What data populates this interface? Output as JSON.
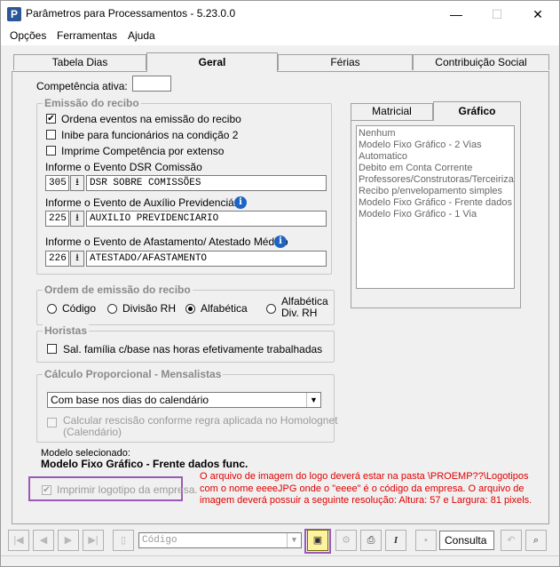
{
  "window": {
    "title": "Parâmetros para Processamentos - 5.23.0.0",
    "icon_letter": "P",
    "controls": {
      "minimize": "—",
      "maximize": "☐",
      "close": "✕"
    }
  },
  "menu": {
    "items": [
      "Opções",
      "Ferramentas",
      "Ajuda"
    ]
  },
  "tabs": [
    "Tabela Dias",
    "Geral",
    "Férias",
    "Contribuição Social"
  ],
  "active_tab": "Geral",
  "competencia": {
    "label": "Competência ativa:",
    "value": ""
  },
  "emissao": {
    "title": "Emissão do recibo",
    "checks": [
      {
        "label": "Ordena eventos na emissão do recibo",
        "checked": true
      },
      {
        "label": "Inibe para funcionários na condição 2",
        "checked": false
      },
      {
        "label": "Imprime Competência por extenso",
        "checked": false
      }
    ],
    "events": [
      {
        "label": "Informe o Evento DSR Comissão",
        "code": "305",
        "desc": "DSR SOBRE COMISSÕES",
        "info": false
      },
      {
        "label": "Informe o Evento de Auxílio Previdenciário",
        "code": "225",
        "desc": "AUXILIO PREVIDENCIARIO",
        "info": true
      },
      {
        "label": "Informe o Evento de Afastamento/ Atestado Médico",
        "code": "226",
        "desc": "ATESTADO/AFASTAMENTO",
        "info": true
      }
    ],
    "dl_glyph": "⭳",
    "info_glyph": "i"
  },
  "ordem": {
    "title": "Ordem de emissão do recibo",
    "options": [
      "Código",
      "Divisão RH",
      "Alfabética",
      "Alfabética",
      "Div. RH"
    ],
    "selected": "Alfabética"
  },
  "horistas": {
    "title": "Horistas",
    "check": {
      "label": "Sal. família c/base nas horas efetivamente trabalhadas",
      "checked": false
    }
  },
  "calculo": {
    "title": "Cálculo Proporcional - Mensalistas",
    "select_value": "Com base nos dias do calendário",
    "check_line1": "Calcular rescisão conforme regra aplicada no Homolognet",
    "check_line2": "(Calendário)"
  },
  "modelo": {
    "label": "Modelo selecionado:",
    "value": "Modelo Fixo Gráfico - Frente dados func."
  },
  "logotipo": {
    "label": "Imprimir logotipo da empresa.",
    "checked": true
  },
  "note": [
    "O arquivo de imagem do logo deverá estar na pasta \\PROEMP??\\Logotipos",
    "com o nome eeeeJPG onde o \"eeee\" é o código da empresa. O arquivo de",
    "imagem deverá possuir a seguinte resolução: Altura: 57 e Largura: 81 pixels."
  ],
  "subtabs": [
    "Matricial",
    "Gráfico"
  ],
  "active_subtab": "Gráfico",
  "models_list": [
    "Nenhum",
    "Modelo Fixo Gráfico - 2 Vias",
    "Automatico",
    "Debito em Conta Corrente",
    "Professores/Construtoras/Terceiriza",
    "Recibo p/envelopamento simples",
    "Modelo Fixo Gráfico - Frente dados",
    "Modelo Fixo Gráfico - 1 Via"
  ],
  "toolbar": {
    "nav": [
      "|◀",
      "◀",
      "▶",
      "▶|"
    ],
    "search_placeholder": "Código",
    "consulta": "Consulta"
  },
  "colors": {
    "note_red": "#e00000",
    "highlight": "#9b59b6",
    "info_blue": "#1e63c4"
  }
}
